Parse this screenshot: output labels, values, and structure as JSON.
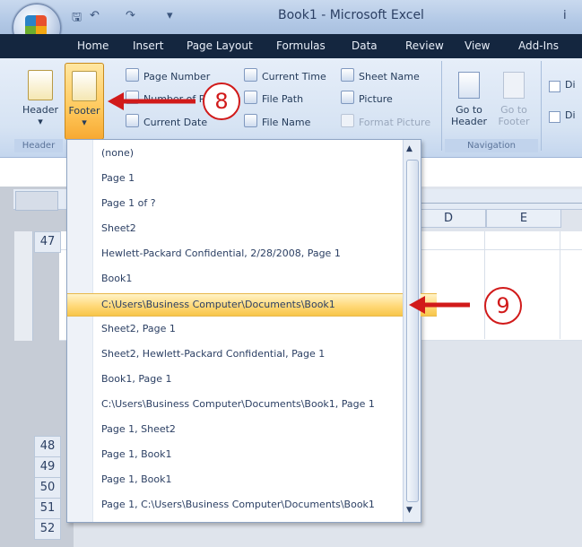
{
  "window": {
    "title": "Book1 - Microsoft Excel",
    "right_glyph": "i"
  },
  "quick_access": {
    "save": "🖫",
    "undo": "↶",
    "redo": "↷",
    "more": "▾"
  },
  "tabs": [
    "Home",
    "Insert",
    "Page Layout",
    "Formulas",
    "Data",
    "Review",
    "View",
    "Add-Ins"
  ],
  "ribbon": {
    "header_label": "Header",
    "footer_label": "Footer",
    "dropdown_arrow": "▾",
    "small_commands": [
      {
        "label": "Page Number"
      },
      {
        "label": "Number of Pages"
      },
      {
        "label": "Current Date"
      },
      {
        "label": "Current Time"
      },
      {
        "label": "File Path"
      },
      {
        "label": "File Name"
      },
      {
        "label": "Sheet Name"
      },
      {
        "label": "Picture"
      },
      {
        "label": "Format Picture"
      }
    ],
    "nav": {
      "goto_header": "Go to\nHeader",
      "goto_footer": "Go to\nFooter",
      "group_label": "Navigation"
    },
    "options": {
      "opt1": "Di",
      "opt2": "Di"
    },
    "group_header_label": "Header"
  },
  "sheet": {
    "columns": [
      "D",
      "E"
    ],
    "rows_top": [
      "47"
    ],
    "rows_bottom": [
      "48",
      "49",
      "50",
      "51",
      "52"
    ]
  },
  "footer_dropdown": {
    "items": [
      "(none)",
      "Page 1",
      "Page 1 of ?",
      "Sheet2",
      "Hewlett-Packard Confidential, 2/28/2008, Page 1",
      "Book1",
      "C:\\Users\\Business Computer\\Documents\\Book1",
      "Sheet2, Page 1",
      "Sheet2, Hewlett-Packard Confidential, Page 1",
      "Book1, Page 1",
      "C:\\Users\\Business Computer\\Documents\\Book1, Page 1",
      "Page 1, Sheet2",
      "Page 1, Book1",
      "Page 1, Book1",
      "Page 1, C:\\Users\\Business Computer\\Documents\\Book1"
    ],
    "selected_index": 6,
    "scroll_up": "▲",
    "scroll_down": "▼"
  },
  "annotations": {
    "step8": "8",
    "step9": "9"
  },
  "colors": {
    "accent_red": "#d11a1a",
    "highlight": "#ffd979"
  }
}
